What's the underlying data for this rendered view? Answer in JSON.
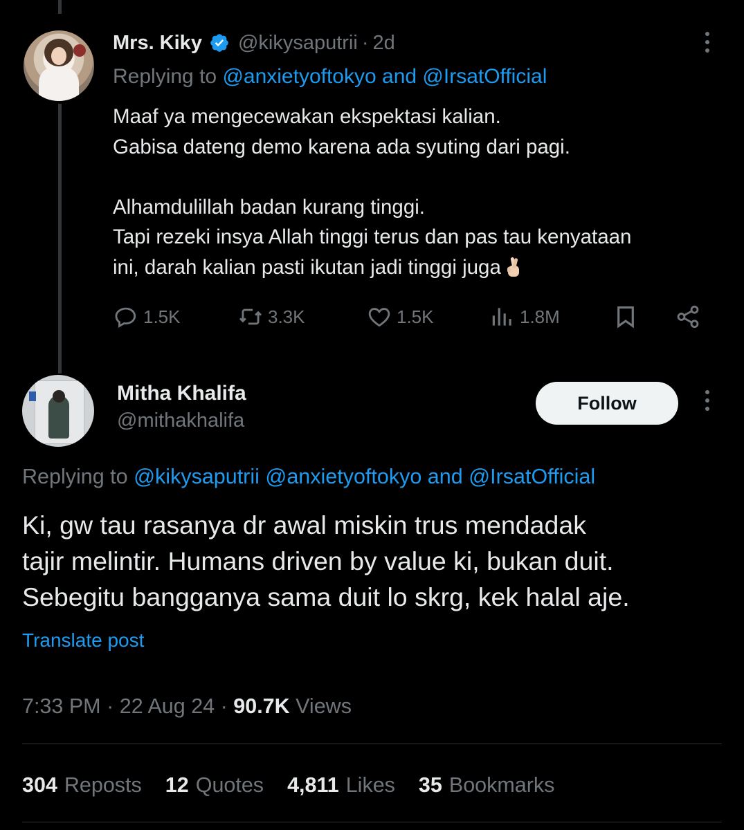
{
  "tweet1": {
    "name": "Mrs. Kiky",
    "handle": "@kikysaputrii",
    "separator": "·",
    "time": "2d",
    "replying_prefix": "Replying to ",
    "replying_mention1": "@anxietyoftokyo",
    "replying_and": "and",
    "replying_mention2": "@IrsatOfficial",
    "lines": [
      "Maaf ya mengecewakan ekspektasi kalian.",
      "Gabisa dateng demo karena ada syuting dari pagi.",
      "",
      "Alhamdulillah badan kurang tinggi.",
      "Tapi rezeki insya Allah tinggi terus dan pas tau kenyataan",
      "ini, darah kalian pasti ikutan jadi tinggi juga"
    ],
    "emoji": "crossed-fingers-emoji",
    "actions": {
      "replies": "1.5K",
      "reposts": "3.3K",
      "likes": "1.5K",
      "views": "1.8M"
    }
  },
  "tweet2": {
    "name": "Mitha Khalifa",
    "handle": "@mithakhalifa",
    "follow_label": "Follow",
    "replying_prefix": "Replying to ",
    "replying_mention1": "@kikysaputrii",
    "replying_mention2": "@anxietyoftokyo",
    "replying_and": "and",
    "replying_mention3": "@IrsatOfficial",
    "lines": [
      "Ki, gw tau rasanya dr awal miskin trus mendadak",
      "tajir melintir. Humans driven by value ki, bukan duit.",
      "Sebegitu bangganya sama duit lo skrg, kek halal aje."
    ],
    "translate_label": "Translate post",
    "time": "7:33 PM",
    "separator": "·",
    "date": "22 Aug 24",
    "views_count": "90.7K",
    "views_label": "Views",
    "stats": {
      "reposts_count": "304",
      "reposts_label": "Reposts",
      "quotes_count": "12",
      "quotes_label": "Quotes",
      "likes_count": "4,811",
      "likes_label": "Likes",
      "bookmarks_count": "35",
      "bookmarks_label": "Bookmarks"
    }
  },
  "colors": {
    "background": "#000000",
    "text": "#e7e9ea",
    "muted": "#71767b",
    "accent": "#1d9bf0",
    "verified": "#1d9bf0"
  }
}
